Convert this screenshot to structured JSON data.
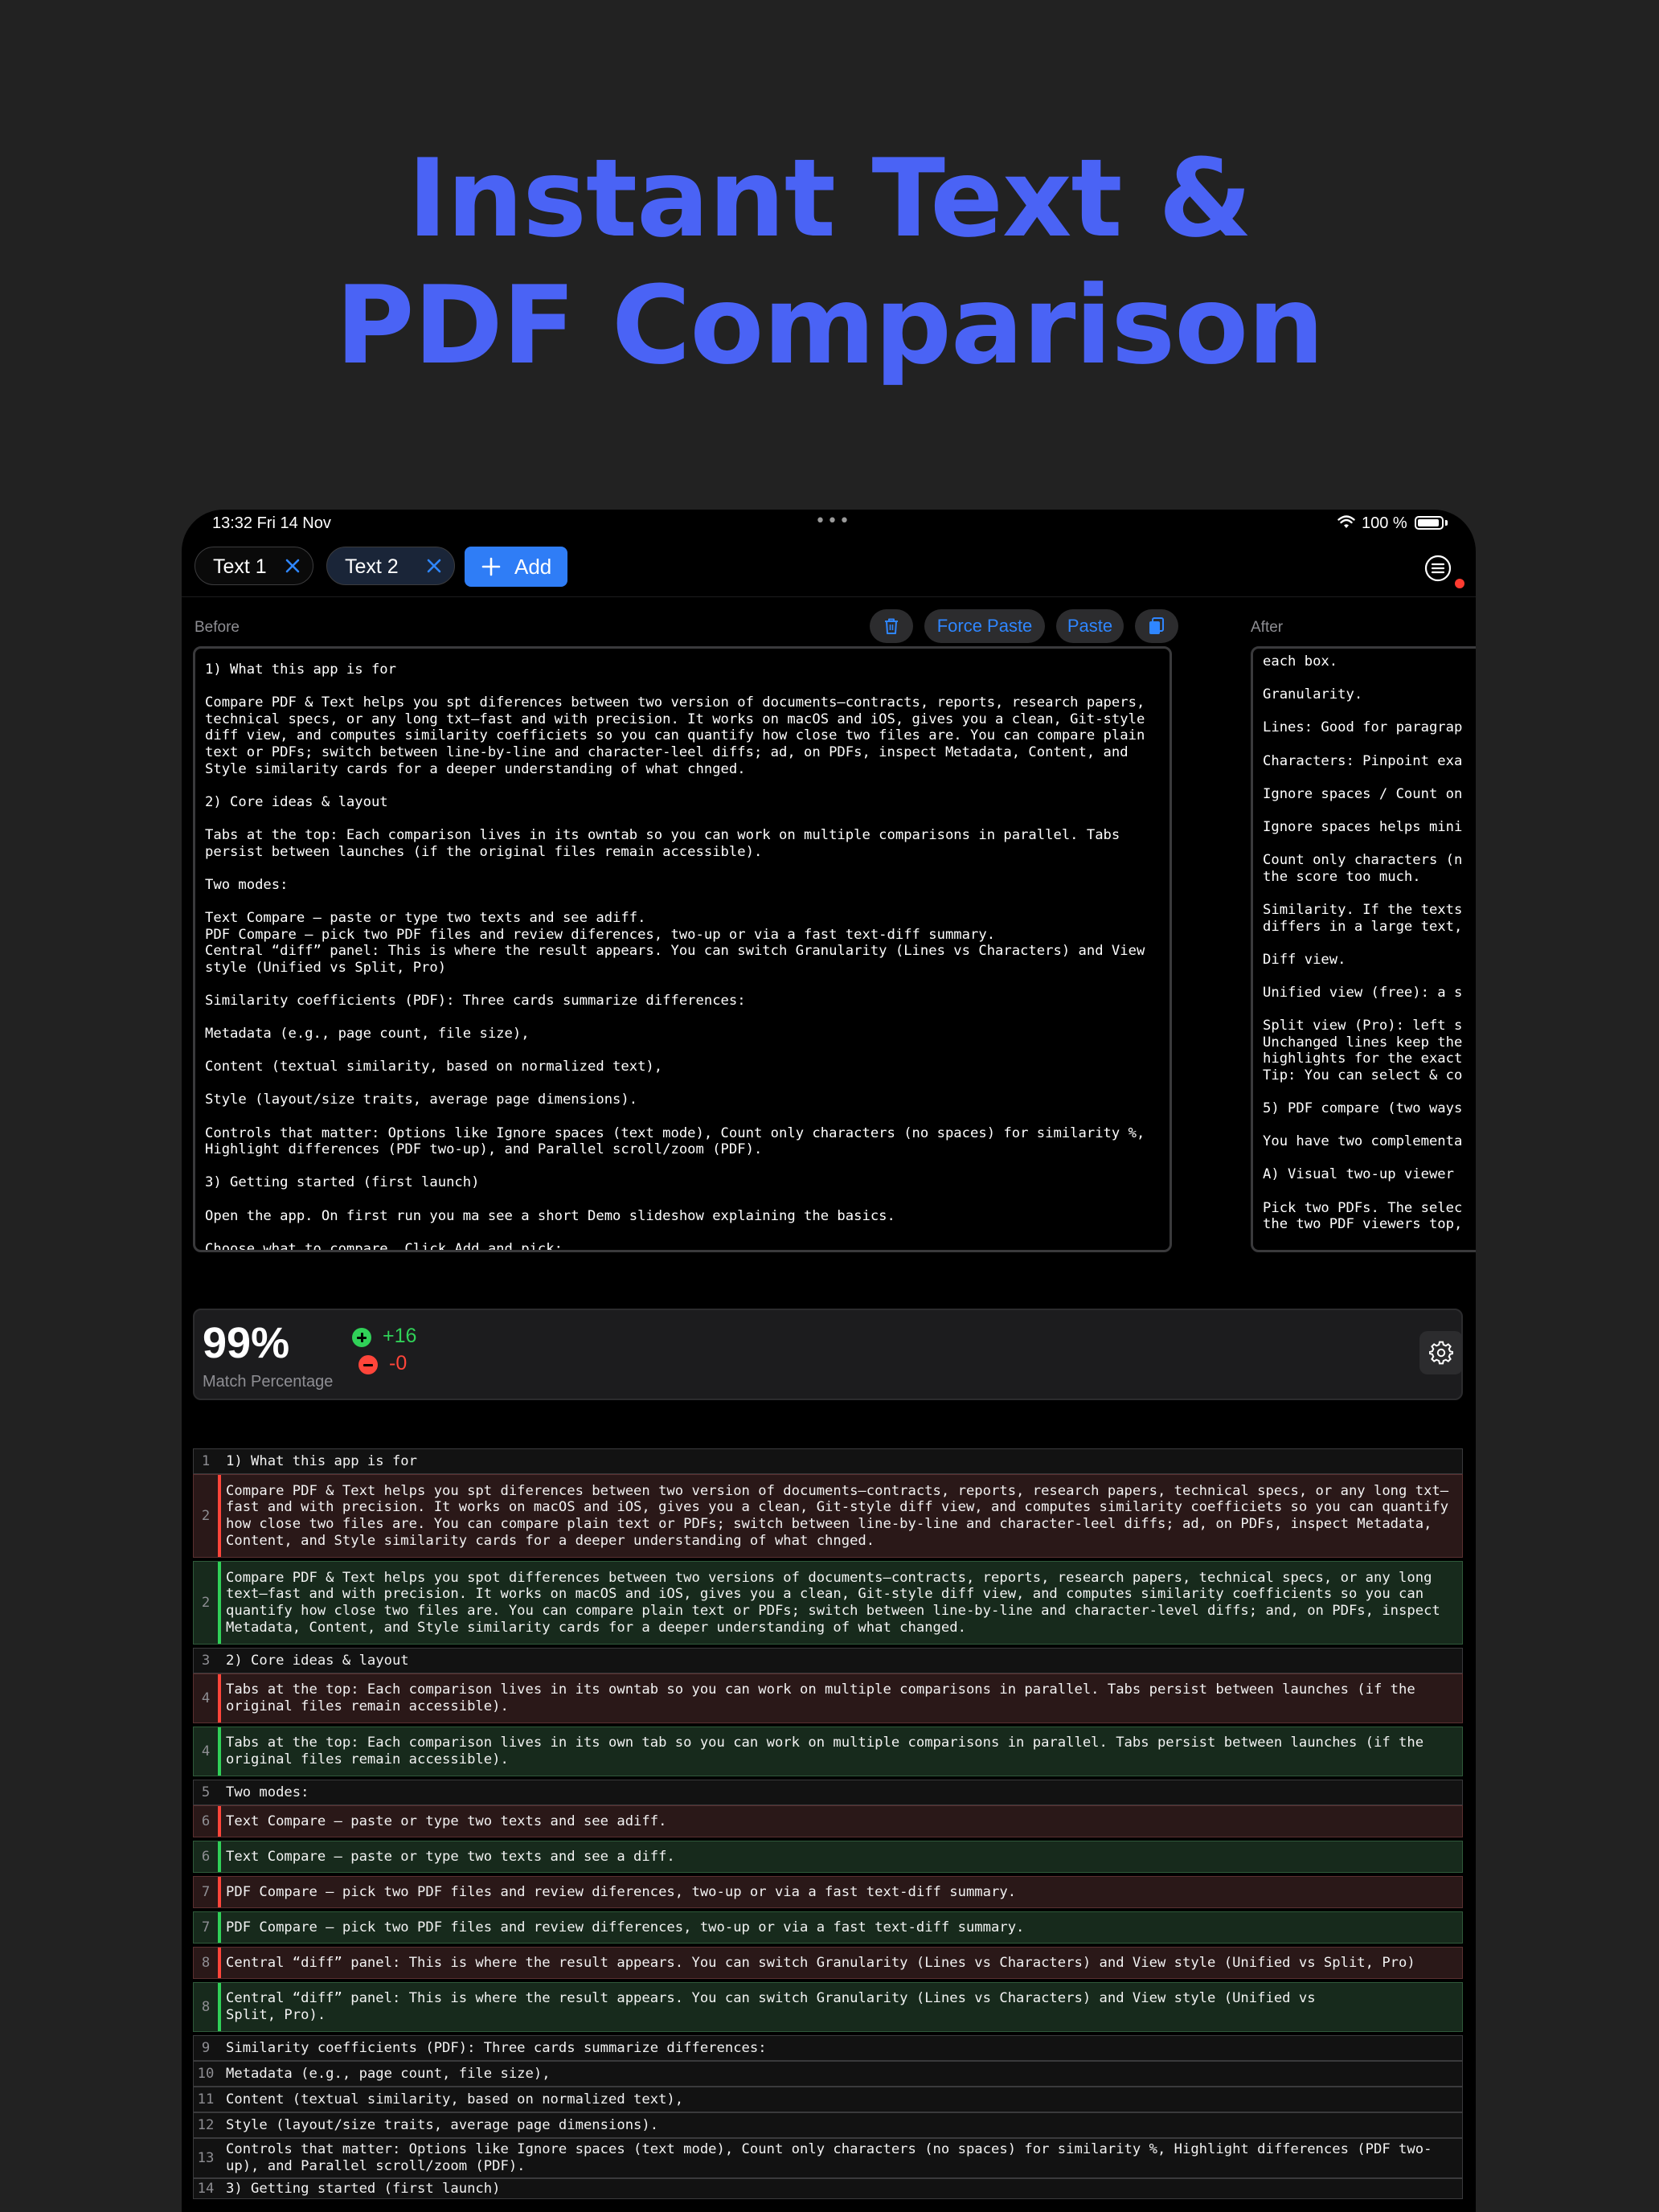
{
  "headline": {
    "line1": "Instant Text &",
    "line2": "PDF Comparison"
  },
  "status_bar": {
    "time": "13:32  Fri 14 Nov",
    "dots": "•••",
    "battery": "100 %"
  },
  "tabs": [
    {
      "label": "Text 1"
    },
    {
      "label": "Text 2"
    }
  ],
  "add_button": {
    "icon": "+",
    "label": "Add"
  },
  "toolbar": {
    "before_label": "Before",
    "after_label": "After",
    "trash_icon": "trash-icon",
    "force_paste": "Force Paste",
    "paste": "Paste",
    "copy_icon": "clipboard-icon"
  },
  "before_text": "1) What this app is for\n\nCompare PDF & Text helps you spt diferences between two version of documents—contracts, reports, research papers, technical specs, or any long txt—fast and with precision. It works on macOS and iOS, gives you a clean, Git-style diff view, and computes similarity coefficiets so you can quantify how close two files are. You can compare plain text or PDFs; switch between line-by-line and character-leel diffs; ad, on PDFs, inspect Metadata, Content, and Style similarity cards for a deeper understanding of what chnged.\n\n2) Core ideas & layout\n\nTabs at the top: Each comparison lives in its owntab so you can work on multiple comparisons in parallel. Tabs persist between launches (if the original files remain accessible).\n\nTwo modes:\n\nText Compare — paste or type two texts and see adiff.\nPDF Compare — pick two PDF files and review diferences, two-up or via a fast text-diff summary.\nCentral “diff” panel: This is where the result appears. You can switch Granularity (Lines vs Characters) and View style (Unified vs Split, Pro)\n\nSimilarity coefficients (PDF): Three cards summarize differences:\n\nMetadata (e.g., page count, file size),\n\nContent (textual similarity, based on normalized text),\n\nStyle (layout/size traits, average page dimensions).\n\nControls that matter: Options like Ignore spaces (text mode), Count only characters (no spaces) for similarity %, Highlight differences (PDF two-up), and Parallel scroll/zoom (PDF).\n\n3) Getting started (first launch)\n\nOpen the app. On first run you ma see a short Demo slideshow explaining the basics.\n\nChoose what to compare. Click Add and pick:",
  "after_lines": [
    "each box.",
    "",
    "Granularity.",
    "",
    "Lines: Good for paragrap",
    "",
    "Characters: Pinpoint exa",
    "",
    "Ignore spaces / Count on",
    "",
    "Ignore spaces helps mini",
    "",
    "Count only characters (n",
    "the score too much.",
    "",
    "Similarity. If the texts",
    "differs in a large text,",
    "",
    "Diff view.",
    "",
    "Unified view (free): a s",
    "",
    "Split view (Pro): left s",
    "Unchanged lines keep the",
    "highlights for the exact",
    "Tip: You can select & co",
    "",
    "5) PDF compare (two ways",
    "",
    "You have two complementa",
    "",
    "A) Visual two-up viewer",
    "",
    "Pick two PDFs. The selec",
    "the two PDF viewers top,"
  ],
  "stats": {
    "match_percent": "99%",
    "match_label": "Match Percentage",
    "added": "+16",
    "removed": "-0"
  },
  "diff_rows": [
    {
      "n": "1",
      "type": "eq",
      "text": "1) What this app is for"
    },
    {
      "n": "2",
      "type": "del",
      "text": "Compare PDF & Text helps you spt diferences between two version of documents—contracts, reports, research papers, technical specs, or any long txt—fast and with precision. It works on macOS and iOS, gives you a clean, Git-style diff view, and computes similarity coefficiets so you can quantify how close two files are. You can compare plain text or PDFs; switch between line-by-line and character-leel diffs; ad, on PDFs, inspect Metadata, Content, and Style similarity cards for a deeper understanding of what chnged."
    },
    {
      "n": "2",
      "type": "add",
      "text": "Compare PDF & Text helps you spot differences between two versions of documents—contracts, reports, research papers, technical specs, or any long text—fast and with precision. It works on macOS and iOS, gives you a clean, Git-style diff view, and computes similarity coefficients so you can quantify how close two files are. You can compare plain text or PDFs; switch between line-by-line and character-level diffs; and, on PDFs, inspect Metadata, Content, and Style similarity cards for a deeper understanding of what changed."
    },
    {
      "n": "3",
      "type": "eq",
      "text": "2) Core ideas & layout"
    },
    {
      "n": "4",
      "type": "del",
      "text": "Tabs at the top: Each comparison lives in its owntab so you can work on multiple comparisons in parallel. Tabs persist between launches (if the original files remain accessible)."
    },
    {
      "n": "4",
      "type": "add",
      "text": "Tabs at the top: Each comparison lives in its own tab so you can work on multiple comparisons in parallel. Tabs persist between launches (if the original files remain accessible)."
    },
    {
      "n": "5",
      "type": "eq",
      "text": "Two modes:"
    },
    {
      "n": "6",
      "type": "del",
      "text": "Text Compare — paste or type two texts and see adiff."
    },
    {
      "n": "6",
      "type": "add",
      "text": "Text Compare — paste or type two texts and see a diff."
    },
    {
      "n": "7",
      "type": "del",
      "text": "PDF Compare — pick two PDF files and review diferences, two-up or via a fast text-diff summary."
    },
    {
      "n": "7",
      "type": "add",
      "text": "PDF Compare — pick two PDF files and review differences, two-up or via a fast text-diff summary."
    },
    {
      "n": "8",
      "type": "del",
      "text": "Central “diff” panel: This is where the result appears. You can switch Granularity (Lines vs Characters) and View style (Unified vs Split, Pro)"
    },
    {
      "n": "8",
      "type": "add",
      "text": "Central “diff” panel: This is where the result appears. You can switch Granularity (Lines vs Characters) and View style (Unified vs\nSplit, Pro)."
    },
    {
      "n": "9",
      "type": "eq",
      "text": "Similarity coefficients (PDF): Three cards summarize differences:"
    },
    {
      "n": "10",
      "type": "eq",
      "text": "Metadata (e.g., page count, file size),"
    },
    {
      "n": "11",
      "type": "eq",
      "text": "Content (textual similarity, based on normalized text),"
    },
    {
      "n": "12",
      "type": "eq",
      "text": "Style (layout/size traits, average page dimensions)."
    },
    {
      "n": "13",
      "type": "eq",
      "text": "Controls that matter: Options like Ignore spaces (text mode), Count only characters (no spaces) for similarity %, Highlight differences (PDF two-up), and Parallel scroll/zoom (PDF)."
    },
    {
      "n": "14",
      "type": "eq",
      "text": "3) Getting started (first launch)"
    }
  ],
  "colors": {
    "accent": "#2f7df6",
    "headline": "#4a63f5",
    "added": "#30d158",
    "removed": "#ff453a"
  }
}
